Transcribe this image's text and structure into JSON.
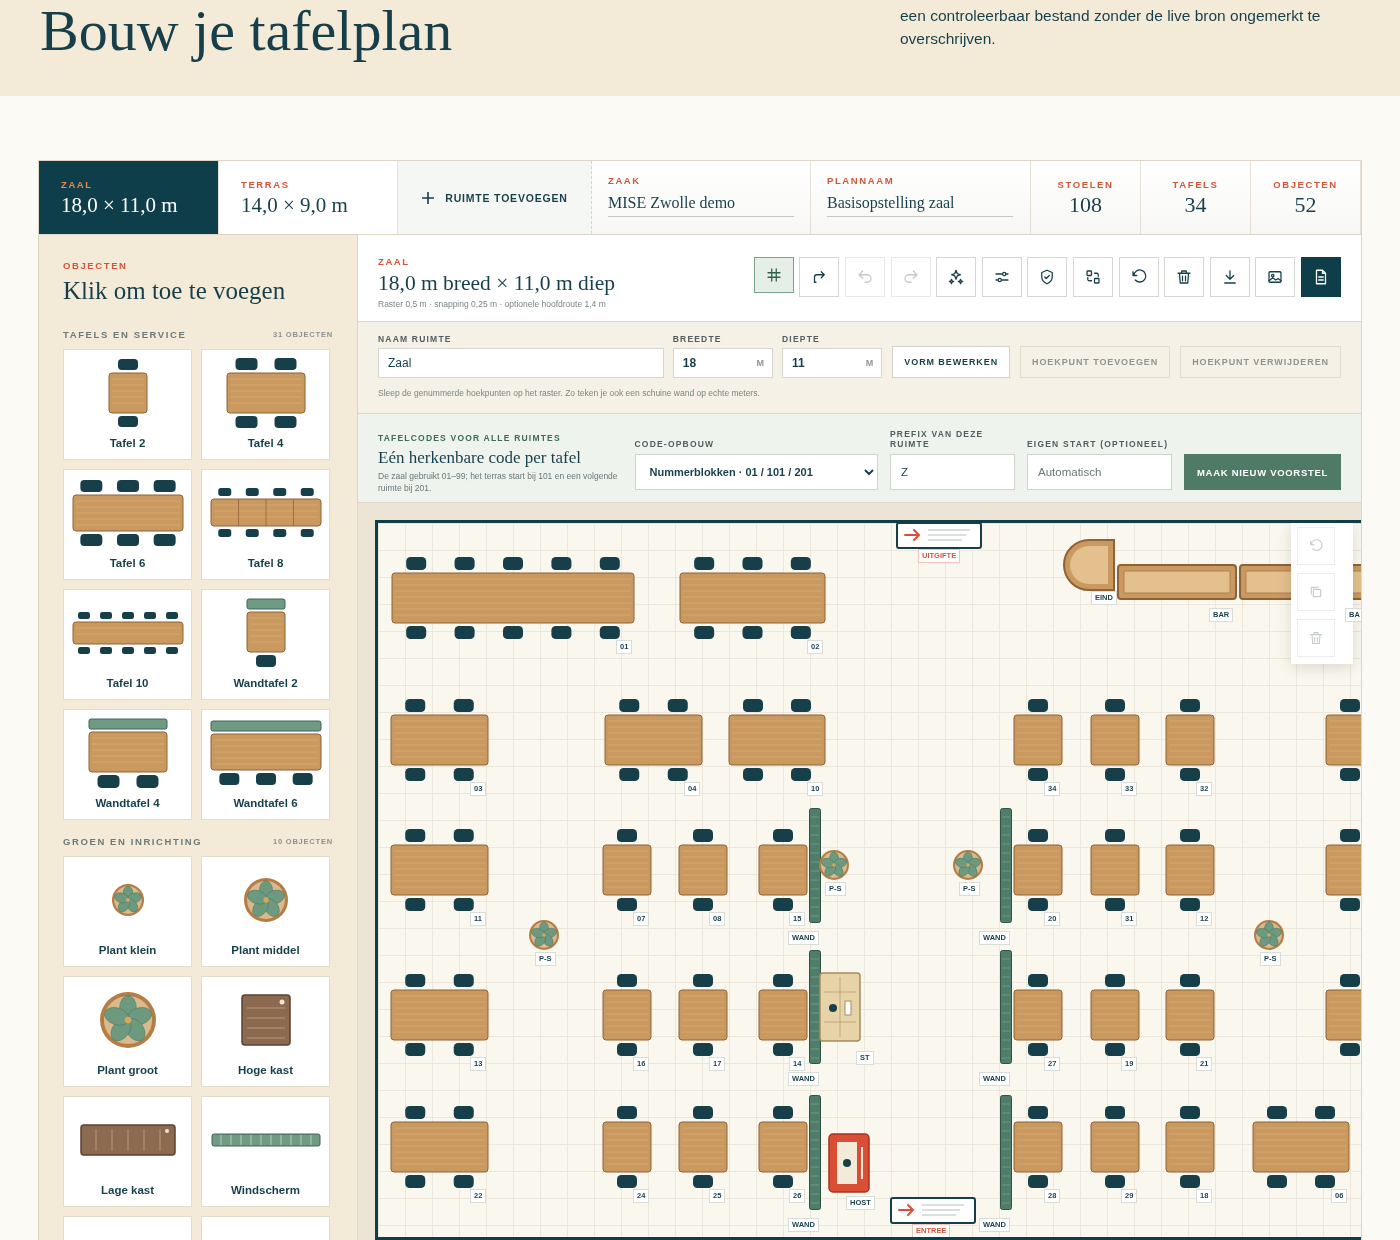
{
  "page_header": {
    "title": "Bouw je tafelplan",
    "intro": "een controleerbaar bestand zonder de live bron ongemerkt te overschrijven."
  },
  "room_tabs": [
    {
      "label": "ZAAL",
      "dimensions": "18,0 × 11,0 m",
      "selected": true
    },
    {
      "label": "TERRAS",
      "dimensions": "14,0 × 9,0 m",
      "selected": false
    }
  ],
  "add_room_button": "RUIMTE TOEVOEGEN",
  "plan_fields": [
    {
      "label": "ZAAK",
      "value": "MISE Zwolle demo"
    },
    {
      "label": "PLANNAAM",
      "value": "Basisopstelling zaal"
    }
  ],
  "stats": [
    {
      "label": "STOELEN",
      "value": "108"
    },
    {
      "label": "TAFELS",
      "value": "34"
    },
    {
      "label": "OBJECTEN",
      "value": "52"
    }
  ],
  "palette": {
    "eyebrow": "OBJECTEN",
    "title": "Klik om toe te voegen",
    "sections": [
      {
        "title": "TAFELS EN SERVICE",
        "count": "31 OBJECTEN",
        "items": [
          {
            "kind": "table-2",
            "label": "Tafel 2"
          },
          {
            "kind": "table-4",
            "label": "Tafel 4"
          },
          {
            "kind": "table-6",
            "label": "Tafel 6"
          },
          {
            "kind": "table-8",
            "label": "Tafel 8"
          },
          {
            "kind": "table-10",
            "label": "Tafel 10"
          },
          {
            "kind": "wall-table-2",
            "label": "Wandtafel 2"
          },
          {
            "kind": "wall-table-4",
            "label": "Wandtafel 4"
          },
          {
            "kind": "wall-table-6",
            "label": "Wandtafel 6"
          }
        ]
      },
      {
        "title": "GROEN EN INRICHTING",
        "count": "10 OBJECTEN",
        "items": [
          {
            "kind": "plant-small",
            "label": "Plant klein"
          },
          {
            "kind": "plant-medium",
            "label": "Plant middel"
          },
          {
            "kind": "plant-large",
            "label": "Plant groot"
          },
          {
            "kind": "tall-cabinet",
            "label": "Hoge kast"
          },
          {
            "kind": "low-cabinet",
            "label": "Lage kast"
          },
          {
            "kind": "windscreen",
            "label": "Windscherm"
          },
          {
            "kind": "cut"
          },
          {
            "kind": "cut"
          }
        ]
      }
    ]
  },
  "room": {
    "eyebrow": "ZAAL",
    "title": "18,0 m breed × 11,0 m diep",
    "meta": "Raster 0,5 m · snapping 0,25 m · optionele hoofdroute 1,4 m"
  },
  "toolbar": [
    {
      "kind": "grid",
      "selected": true,
      "disabled": false,
      "primary": false
    },
    {
      "kind": "export-arrow",
      "selected": false,
      "disabled": false,
      "primary": false
    },
    {
      "kind": "undo",
      "selected": false,
      "disabled": true,
      "primary": false
    },
    {
      "kind": "redo",
      "selected": false,
      "disabled": true,
      "primary": false
    },
    {
      "kind": "sparkles",
      "selected": false,
      "disabled": false,
      "primary": false
    },
    {
      "kind": "sliders",
      "selected": false,
      "disabled": false,
      "primary": false
    },
    {
      "kind": "shield",
      "selected": false,
      "disabled": false,
      "primary": false
    },
    {
      "kind": "swap",
      "selected": false,
      "disabled": false,
      "primary": false
    },
    {
      "kind": "reset",
      "selected": false,
      "disabled": false,
      "primary": false
    },
    {
      "kind": "delete",
      "selected": false,
      "disabled": false,
      "primary": false
    },
    {
      "kind": "download",
      "selected": false,
      "disabled": false,
      "primary": false
    },
    {
      "kind": "image",
      "selected": false,
      "disabled": false,
      "primary": false
    },
    {
      "kind": "document",
      "selected": false,
      "disabled": false,
      "primary": true
    }
  ],
  "room_form": {
    "fields": [
      {
        "label": "NAAM RUIMTE",
        "value": "Zaal"
      },
      {
        "label": "BREEDTE",
        "value": "18",
        "unit": "M"
      },
      {
        "label": "DIEPTE",
        "value": "11",
        "unit": "M"
      }
    ],
    "buttons": [
      {
        "label": "VORM BEWERKEN",
        "disabled": false
      },
      {
        "label": "HOEKPUNT TOEVOEGEN",
        "disabled": true
      },
      {
        "label": "HOEKPUNT VERWIJDEREN",
        "disabled": true
      }
    ],
    "hint": "Sleep de genummerde hoekpunten op het raster. Zo teken je ook een schuine wand op echte meters."
  },
  "table_codes": {
    "eyebrow": "TAFELCODES VOOR ALLE RUIMTES",
    "title": "Eén herkenbare code per tafel",
    "description": "De zaal gebruikt 01–99; het terras start bij 101 en een volgende ruimte bij 201.",
    "structure": {
      "label": "CODE-OPBOUW",
      "value": "Nummerblokken · 01 / 101 / 201"
    },
    "prefix": {
      "label": "PREFIX VAN DEZE RUIMTE",
      "value": "Z"
    },
    "start": {
      "label": "EIGEN START (OPTIONEEL)",
      "placeholder": "Automatisch"
    },
    "button": "MAAK NIEUW VOORSTEL"
  },
  "floor_plan": {
    "objects": [
      {
        "kind": "table",
        "code": "01"
      },
      {
        "kind": "table",
        "code": "02"
      },
      {
        "kind": "table",
        "code": "03"
      },
      {
        "kind": "table",
        "code": "04"
      },
      {
        "kind": "table",
        "code": "10"
      },
      {
        "kind": "table",
        "code": "34"
      },
      {
        "kind": "table",
        "code": "33"
      },
      {
        "kind": "table",
        "code": "32"
      },
      {
        "kind": "table"
      },
      {
        "kind": "table",
        "code": "11"
      },
      {
        "kind": "table",
        "code": "07"
      },
      {
        "kind": "table",
        "code": "08"
      },
      {
        "kind": "table",
        "code": "15"
      },
      {
        "kind": "table",
        "code": "20"
      },
      {
        "kind": "table",
        "code": "31"
      },
      {
        "kind": "table",
        "code": "12"
      },
      {
        "kind": "table"
      },
      {
        "kind": "table",
        "code": "13"
      },
      {
        "kind": "table",
        "code": "16"
      },
      {
        "kind": "table",
        "code": "17"
      },
      {
        "kind": "table",
        "code": "14"
      },
      {
        "kind": "table",
        "code": "27"
      },
      {
        "kind": "table",
        "code": "19"
      },
      {
        "kind": "table",
        "code": "21"
      },
      {
        "kind": "table"
      },
      {
        "kind": "table",
        "code": "22"
      },
      {
        "kind": "table",
        "code": "24"
      },
      {
        "kind": "table",
        "code": "25"
      },
      {
        "kind": "table",
        "code": "26"
      },
      {
        "kind": "table",
        "code": "28"
      },
      {
        "kind": "table",
        "code": "29"
      },
      {
        "kind": "table",
        "code": "18"
      },
      {
        "kind": "table",
        "code": "06"
      },
      {
        "kind": "wall",
        "label": "WAND"
      },
      {
        "kind": "wall",
        "label": "WAND"
      },
      {
        "kind": "wall",
        "label": "WAND"
      },
      {
        "kind": "wall",
        "label": "WAND"
      },
      {
        "kind": "wall",
        "label": "WAND"
      },
      {
        "kind": "wall",
        "label": "WAND"
      },
      {
        "kind": "plant",
        "label": "P-S"
      },
      {
        "kind": "plant",
        "label": "P-S"
      },
      {
        "kind": "plant",
        "label": "P-S"
      },
      {
        "kind": "plant",
        "label": "P-S"
      },
      {
        "kind": "station",
        "label": "ST"
      },
      {
        "kind": "host",
        "label": "HOST"
      },
      {
        "kind": "exit",
        "label": "UITGIFTE"
      },
      {
        "kind": "exit",
        "label": "ENTREE"
      },
      {
        "kind": "bar_end",
        "label": "EIND"
      },
      {
        "kind": "bar",
        "label": "BAR"
      },
      {
        "kind": "bar",
        "label": "BA"
      }
    ],
    "selection_tools": [
      {
        "kind": "rotate",
        "disabled": true
      },
      {
        "kind": "duplicate",
        "disabled": true
      },
      {
        "kind": "delete",
        "disabled": true
      }
    ]
  }
}
